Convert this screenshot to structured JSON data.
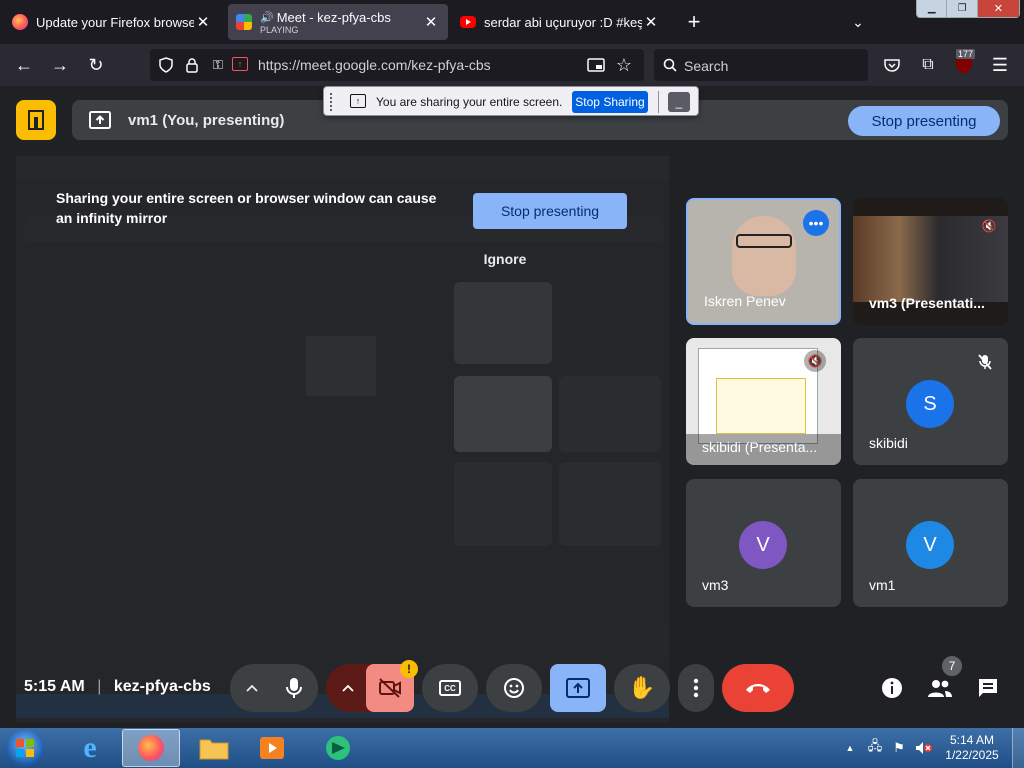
{
  "browser": {
    "tabs": [
      {
        "title": "Update your Firefox browser",
        "active": false
      },
      {
        "title": "Meet - kez-pfya-cbs",
        "subtitle": "PLAYING",
        "active": true
      },
      {
        "title": "serdar abi uçuruyor :D #keşfet",
        "active": false
      }
    ],
    "url": "https://meet.google.com/kez-pfya-cbs",
    "url_domain": "meet.google.com",
    "search_placeholder": "Search",
    "extension_badge": "177"
  },
  "share_bar": {
    "message": "You are sharing your entire screen.",
    "stop_label": "Stop Sharing",
    "hide_label": "_"
  },
  "meet": {
    "presenting_label": "vm1 (You, presenting)",
    "stop_presenting_top": "Stop presenting",
    "infinity_warning": "Sharing your entire screen or browser window can cause an infinity mirror",
    "stop_presenting_warning": "Stop presenting",
    "ignore_label": "Ignore",
    "participants": [
      {
        "name": "Iskren Penev"
      },
      {
        "name": "vm3 (Presentati..."
      },
      {
        "name": "skibidi (Presenta..."
      },
      {
        "name": "skibidi",
        "initial": "S",
        "color": "#1a73e8"
      },
      {
        "name": "vm3",
        "initial": "V",
        "color": "#7e57c2"
      },
      {
        "name": "vm1",
        "initial": "V",
        "color": "#1e88e5"
      }
    ],
    "time": "5:15 AM",
    "separator": "|",
    "meeting_code": "kez-pfya-cbs",
    "people_count": "7",
    "warning_mark": "!"
  },
  "colors": {
    "accent": "#8ab4f8",
    "end_call": "#ea4335",
    "camera_off": "#f28b82",
    "share_active": "#8ab4f8",
    "yellow_logo": "#fbbc04"
  },
  "taskbar": {
    "clock_time": "5:14 AM",
    "clock_date": "1/22/2025"
  }
}
